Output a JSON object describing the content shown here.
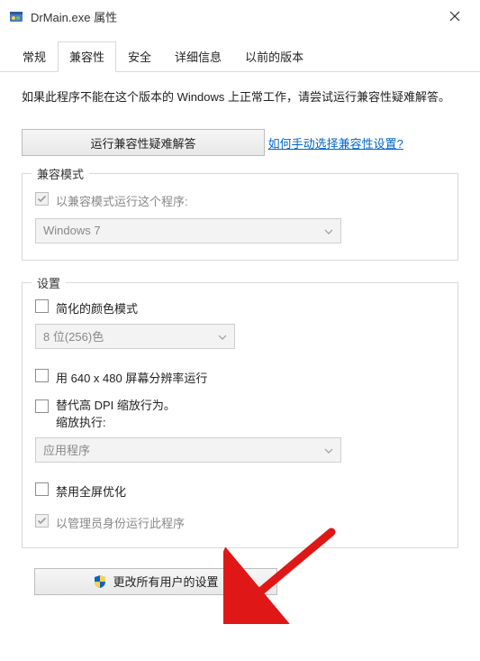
{
  "window": {
    "title": "DrMain.exe 属性"
  },
  "tabs": [
    {
      "label": "常规",
      "active": false
    },
    {
      "label": "兼容性",
      "active": true
    },
    {
      "label": "安全",
      "active": false
    },
    {
      "label": "详细信息",
      "active": false
    },
    {
      "label": "以前的版本",
      "active": false
    }
  ],
  "intro_text": "如果此程序不能在这个版本的 Windows 上正常工作，请尝试运行兼容性疑难解答。",
  "troubleshooter_button": "运行兼容性疑难解答",
  "manual_link": "如何手动选择兼容性设置?",
  "compat_mode": {
    "legend": "兼容模式",
    "checkbox_label": "以兼容模式运行这个程序:",
    "checkbox_checked": true,
    "checkbox_disabled": true,
    "dropdown_value": "Windows 7"
  },
  "settings": {
    "legend": "设置",
    "reduced_color": {
      "label": "简化的颜色模式",
      "checked": false,
      "dropdown_value": "8 位(256)色"
    },
    "low_res": {
      "label": "用 640 x 480 屏幕分辨率运行",
      "checked": false
    },
    "dpi_override": {
      "label_line1": "替代高 DPI 缩放行为。",
      "label_line2": "缩放执行:",
      "checked": false,
      "dropdown_value": "应用程序"
    },
    "disable_fullscreen": {
      "label": "禁用全屏优化",
      "checked": false
    },
    "run_as_admin": {
      "label": "以管理员身份运行此程序",
      "checked": true,
      "disabled": true
    }
  },
  "change_all_users_button": "更改所有用户的设置"
}
